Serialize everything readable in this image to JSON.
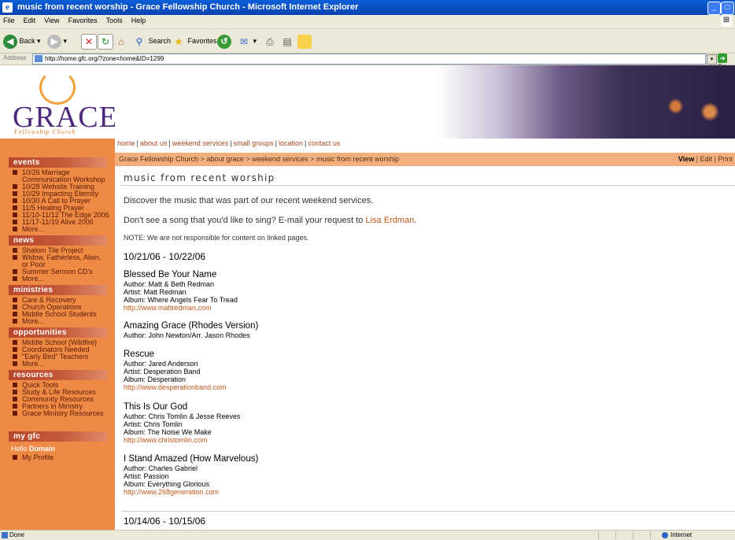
{
  "window": {
    "title": "music from recent worship - Grace Fellowship Church - Microsoft Internet Explorer"
  },
  "menu": [
    "File",
    "Edit",
    "View",
    "Favorites",
    "Tools",
    "Help"
  ],
  "toolbar": {
    "back": "Back",
    "search": "Search",
    "favorites": "Favorites"
  },
  "address": {
    "label": "Address",
    "url": "http://home.gfc.org/?zone=home&ID=1299",
    "go": "Go"
  },
  "logo": {
    "text": "GRACE",
    "sub": "Fellowship Church"
  },
  "topnav": [
    "home",
    "about us",
    "weekend services",
    "small groups",
    "location",
    "contact us"
  ],
  "breadcrumb": [
    "Grace Fellowship Church",
    "about grace",
    "weekend services",
    "music from recent worship"
  ],
  "actions": {
    "view": "View",
    "edit": "Edit",
    "print": "Print"
  },
  "sidebar": {
    "sections": [
      {
        "title": "events",
        "items": [
          "10/26 Marriage",
          "Communication Workshop",
          "10/28 Website Training",
          "10/29 Impacting Eternity",
          "10/30 A Call to Prayer",
          "11/5 Healing Prayer",
          "11/10-11/12 The Edge 2006",
          "11/17-11/19 Alive 2006",
          "More..."
        ]
      },
      {
        "title": "news",
        "items": [
          "Shalom Tile Project",
          "Widow, Fatherless, Alien,",
          "or Poor",
          "Summer Sermon CD's",
          "More..."
        ]
      },
      {
        "title": "ministries",
        "items": [
          "Care & Recovery",
          "Church Operations",
          "Middle School Students",
          "More..."
        ]
      },
      {
        "title": "opportunities",
        "items": [
          "Middle School (Wildfire)",
          "Coordinators Needed",
          "\"Early Bird\" Teachers",
          "More..."
        ]
      },
      {
        "title": "resources",
        "items": [
          "Quick Tools",
          "Study & Life Resources",
          "Community Resources",
          "Partners in Ministry",
          "Grace Ministry Resources"
        ]
      },
      {
        "title": "my gfc",
        "items": [
          "My Profile"
        ]
      }
    ],
    "hello_prefix": "Hello",
    "hello_name": "Domain"
  },
  "content": {
    "title": "music from recent worship",
    "intro": "Discover the music that was part of our recent weekend services.",
    "request_prefix": "Don't see a song that you'd like to sing?  E-mail your request to",
    "request_name": "Lisa Erdman",
    "request_suffix": ".",
    "note": "NOTE: We are not responsible for content on linked pages.",
    "date1": "10/21/06 - 10/22/06",
    "songs": [
      {
        "title": "Blessed Be Your Name",
        "lines": [
          "Author: Matt & Beth Redman",
          "Artist: Matt Redman",
          "Album: Where Angels Fear To Tread"
        ],
        "link": "http://www.mattredman.com"
      },
      {
        "title": "Amazing Grace (Rhodes Version)",
        "lines": [
          "Author: John Newton/Arr. Jason Rhodes"
        ],
        "link": ""
      },
      {
        "title": "Rescue",
        "lines": [
          "Author: Jared Anderson",
          "Artist: Desperation Band",
          "Album: Desperation"
        ],
        "link": "http://www.desperationband.com"
      },
      {
        "title": "This Is Our God",
        "lines": [
          "Author: Chris Tomlin & Jesse Reeves",
          "Artist: Chris Tomlin",
          "Album: The Noise We Make"
        ],
        "link": "http://www.christomlin.com"
      },
      {
        "title": "I Stand Amazed (How Marvelous)",
        "lines": [
          "Author: Charles Gabriel",
          "Artist: Passion",
          "Album: Everything Glorious"
        ],
        "link": "http://www.268generation.com"
      }
    ],
    "date2": "10/14/06 - 10/15/06"
  },
  "status": {
    "text": "Done",
    "zone": "Internet"
  }
}
